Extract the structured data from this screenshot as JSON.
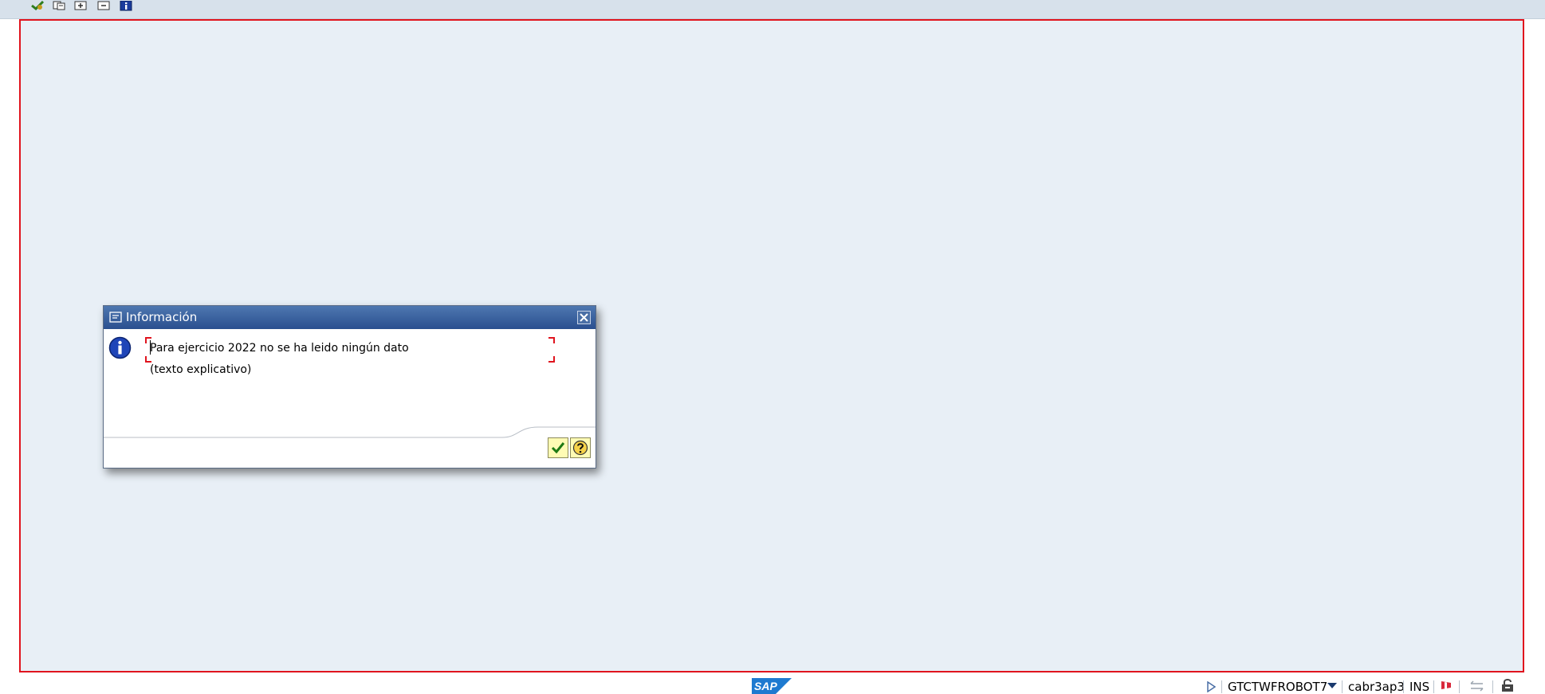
{
  "toolbar": {
    "icons": [
      "check-green-icon",
      "copy-icon",
      "expand-icon",
      "collapse-icon",
      "info-icon"
    ]
  },
  "dialog": {
    "title": "Información",
    "message_line1": "Para ejercicio 2022 no se ha leido ningún dato",
    "message_line2": "(texto explicativo)",
    "buttons": [
      "continue-check-icon",
      "help-icon"
    ]
  },
  "statusbar": {
    "logo": "SAP",
    "system": "GTCTWFROBOT7",
    "server": "cabr3ap3",
    "mode": "INS"
  },
  "colors": {
    "frame_red": "#e0141e",
    "work_bg": "#e8eff6",
    "title_blue": "#2a4f8f",
    "button_yellow": "#fffbb4"
  }
}
